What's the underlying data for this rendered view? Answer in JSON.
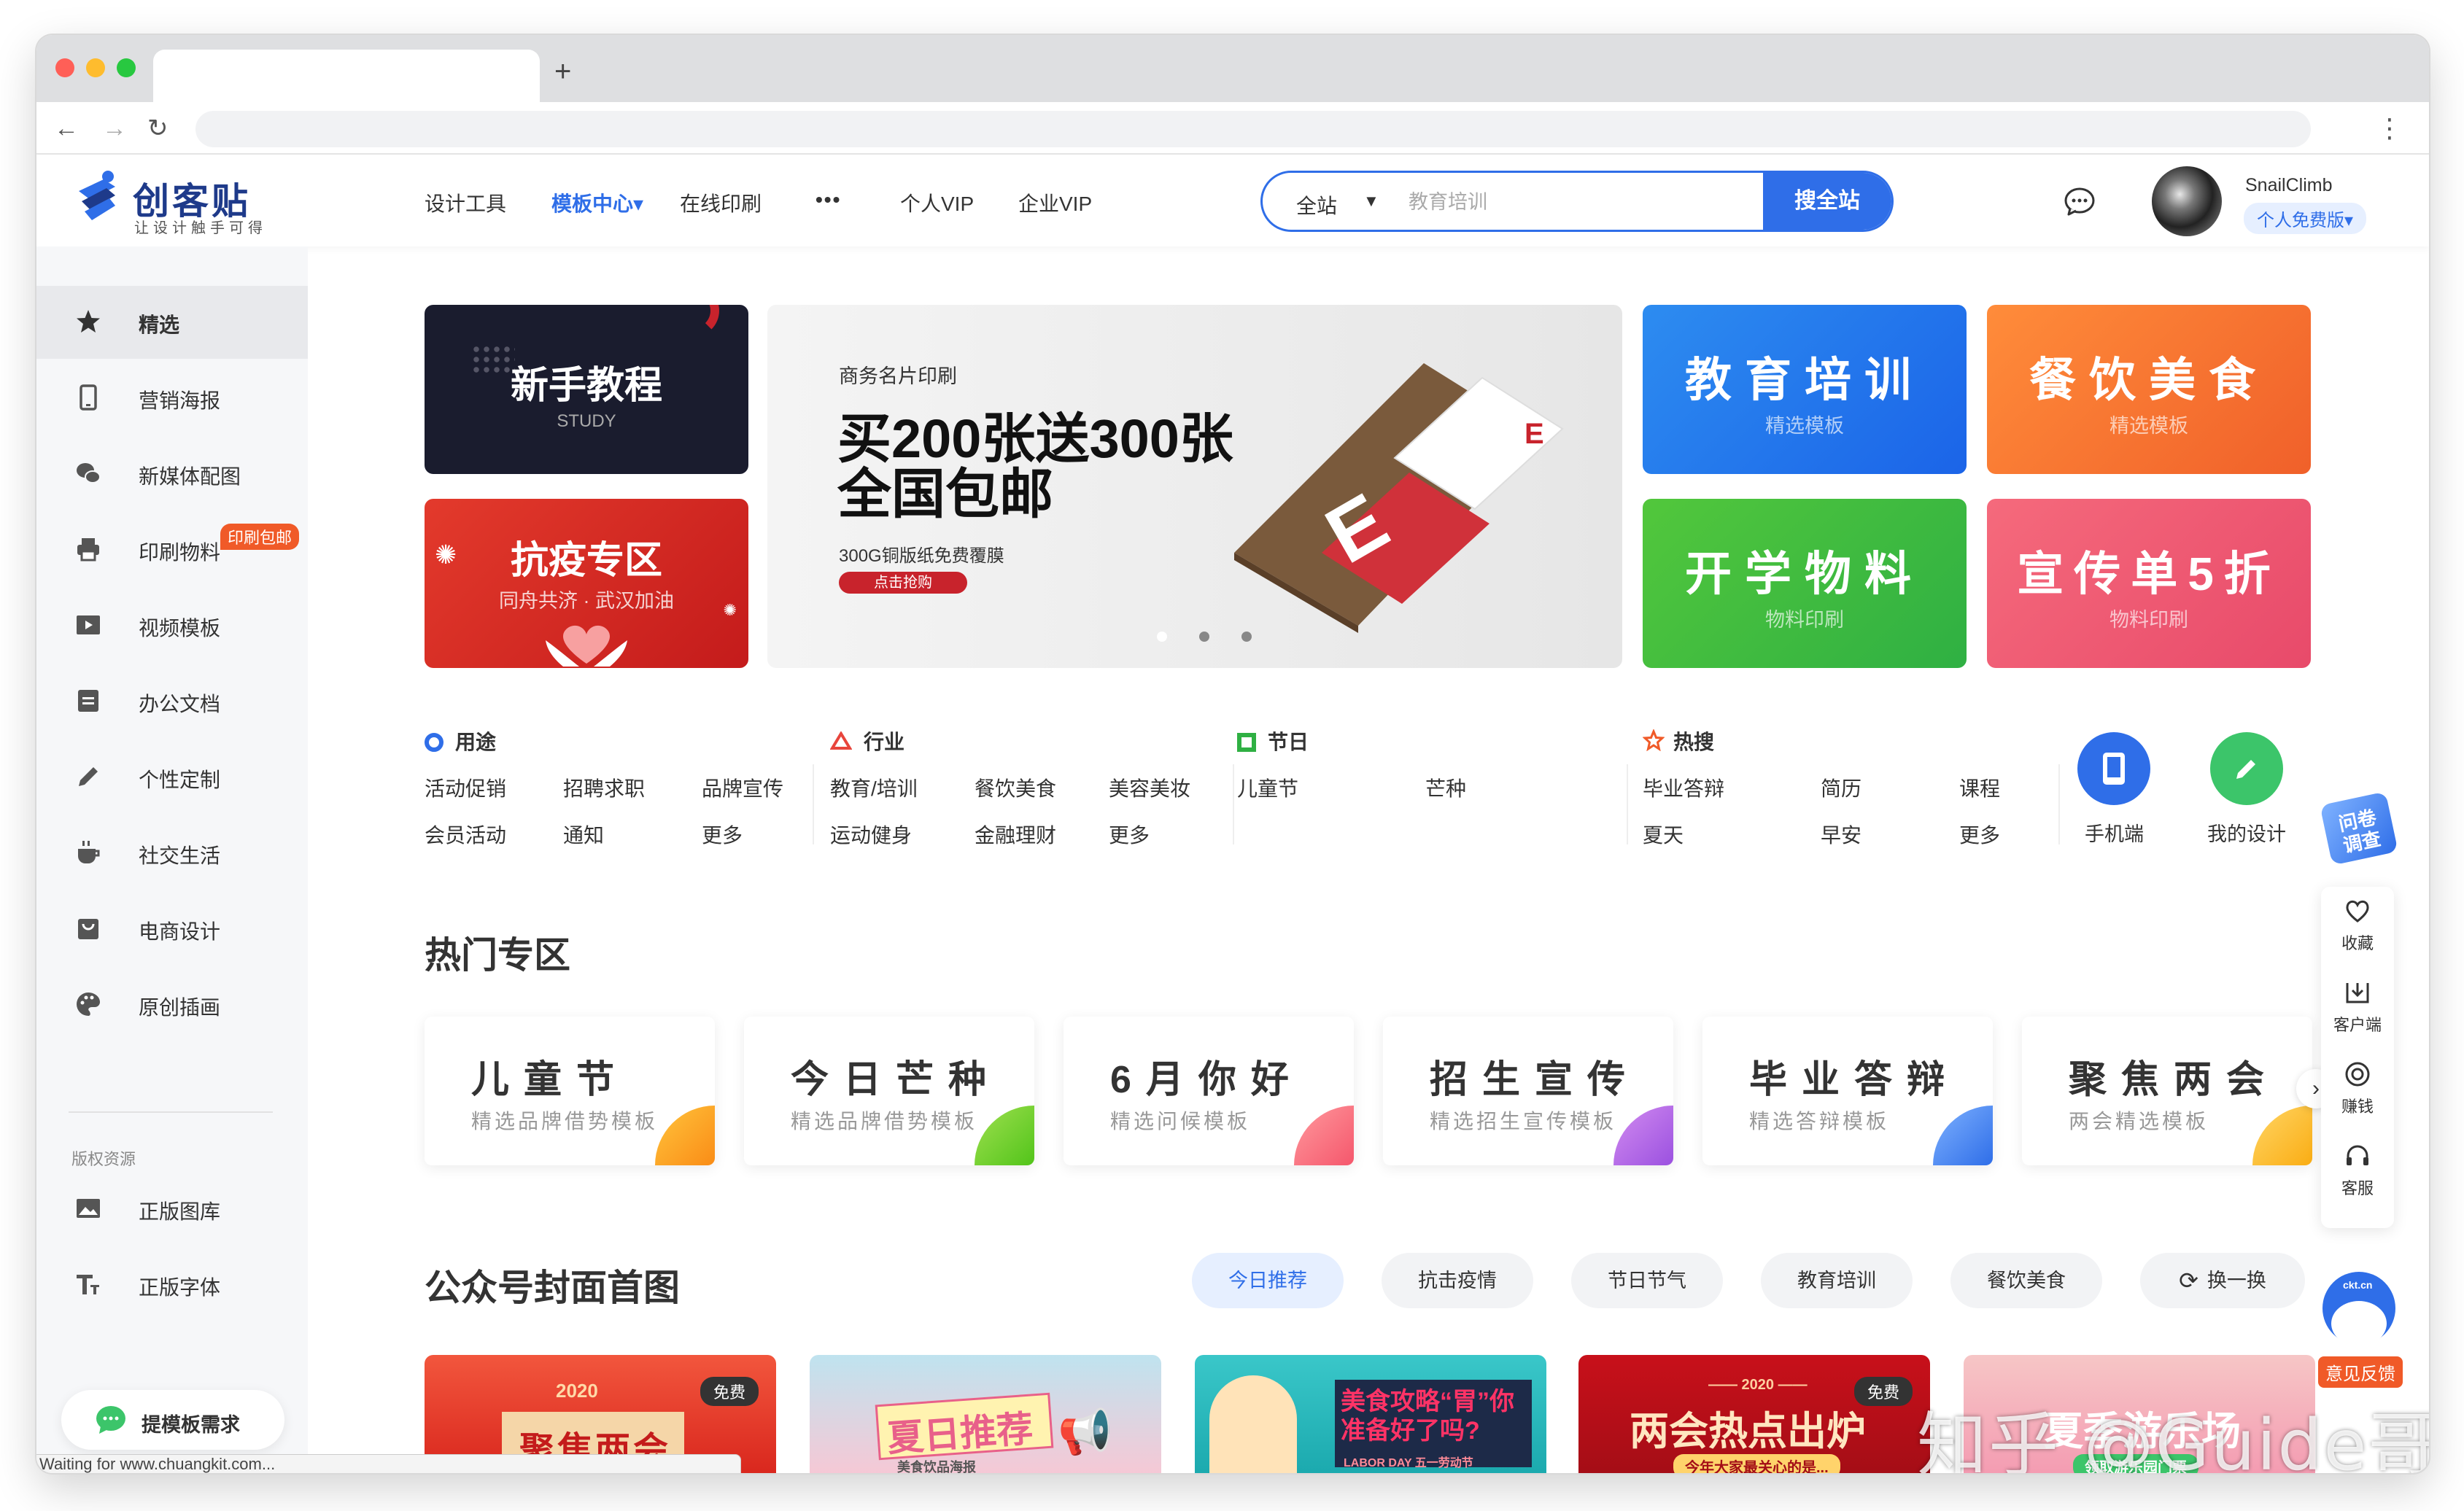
{
  "browser": {
    "new_tab": "+",
    "back": "←",
    "forward": "→",
    "reload": "↻",
    "menu": "⋮",
    "status": "Waiting for www.chuangkit.com..."
  },
  "header": {
    "logo": "创客贴",
    "logo_sub": "让设计触手可得",
    "nav": [
      "设计工具",
      "模板中心",
      "在线印刷",
      "•••",
      "个人VIP",
      "企业VIP"
    ],
    "nav_active_caret": "▾",
    "search_scope": "全站",
    "search_caret": "▼",
    "search_placeholder": "教育培训",
    "search_button": "搜全站",
    "username": "SnailClimb",
    "vip_badge": "个人免费版▾"
  },
  "sidebar": {
    "items": [
      {
        "label": "精选",
        "icon": "star-icon"
      },
      {
        "label": "营销海报",
        "icon": "phone-icon"
      },
      {
        "label": "新媒体配图",
        "icon": "wechat-icon"
      },
      {
        "label": "印刷物料",
        "icon": "printer-icon",
        "badge": "印刷包邮"
      },
      {
        "label": "视频模板",
        "icon": "video-icon"
      },
      {
        "label": "办公文档",
        "icon": "document-icon"
      },
      {
        "label": "个性定制",
        "icon": "pencil-icon"
      },
      {
        "label": "社交生活",
        "icon": "coffee-icon"
      },
      {
        "label": "电商设计",
        "icon": "shop-icon"
      },
      {
        "label": "原创插画",
        "icon": "palette-icon"
      }
    ],
    "section_label": "版权资源",
    "resources": [
      {
        "label": "正版图库",
        "icon": "image-icon"
      },
      {
        "label": "正版字体",
        "icon": "font-icon"
      }
    ],
    "request_button": "提模板需求"
  },
  "banners": {
    "tutorial": {
      "title": "新手教程",
      "sub": "STUDY"
    },
    "epidemic": {
      "title": "抗疫专区",
      "sub": "同舟共济 · 武汉加油"
    },
    "hero": {
      "kicker": "商务名片印刷",
      "line1": "买200张送300张",
      "line2": "全国包邮",
      "detail": "300G铜版纸免费覆膜",
      "cta": "点击抢购"
    },
    "tiles": [
      {
        "title": "教育培训",
        "sub": "精选模板"
      },
      {
        "title": "餐饮美食",
        "sub": "精选模板"
      },
      {
        "title": "开学物料",
        "sub": "物料印刷"
      },
      {
        "title": "宣传单5折",
        "sub": "物料印刷"
      }
    ]
  },
  "categories": {
    "usage": {
      "title": "用途",
      "links": [
        "活动促销",
        "招聘求职",
        "品牌宣传",
        "会员活动",
        "通知",
        "更多"
      ]
    },
    "industry": {
      "title": "行业",
      "links": [
        "教育/培训",
        "餐饮美食",
        "美容美妆",
        "运动健身",
        "金融理财",
        "更多"
      ]
    },
    "festival": {
      "title": "节日",
      "links": [
        "儿童节",
        "芒种"
      ]
    },
    "hot": {
      "title": "热搜",
      "links": [
        "毕业答辩",
        "简历",
        "课程",
        "夏天",
        "早安",
        "更多"
      ]
    },
    "mobile": "手机端",
    "my_design": "我的设计"
  },
  "hot_section": {
    "title": "热门专区",
    "cards": [
      {
        "title": "儿童节",
        "sub": "精选品牌借势模板"
      },
      {
        "title": "今日芒种",
        "sub": "精选品牌借势模板"
      },
      {
        "title": "6月你好",
        "sub": "精选问候模板"
      },
      {
        "title": "招生宣传",
        "sub": "精选招生宣传模板"
      },
      {
        "title": "毕业答辩",
        "sub": "精选答辩模板"
      },
      {
        "title": "聚焦两会",
        "sub": "两会精选模板"
      }
    ],
    "next": "›"
  },
  "cover_section": {
    "title": "公众号封面首图",
    "tabs": [
      "今日推荐",
      "抗击疫情",
      "节日节气",
      "教育培训",
      "餐饮美食"
    ],
    "refresh": "换一换",
    "thumbs": [
      {
        "text": "聚焦两会",
        "year": "2020",
        "badge": "免费"
      },
      {
        "text": "夏日推荐",
        "sub": "美食饮品海报"
      },
      {
        "text": "美食攻略“胃”你准备好了吗?",
        "sub": "LABOR DAY 五一劳动节"
      },
      {
        "text": "两会热点出炉",
        "year": "—— 2020 ——",
        "sub": "今年大家最关心的是...",
        "badge": "免费"
      },
      {
        "text": "夏季游乐场",
        "sub": "领取游乐园门票"
      }
    ]
  },
  "float_bar": {
    "survey": "问卷调查",
    "items": [
      {
        "label": "收藏",
        "icon": "heart-icon"
      },
      {
        "label": "客户端",
        "icon": "download-icon"
      },
      {
        "label": "赚钱",
        "icon": "coin-icon"
      },
      {
        "label": "客服",
        "icon": "headset-icon"
      }
    ],
    "feedback": "意见反馈",
    "feedback_tag": "ckt.cn"
  },
  "watermark": "知乎 @Guide哥"
}
